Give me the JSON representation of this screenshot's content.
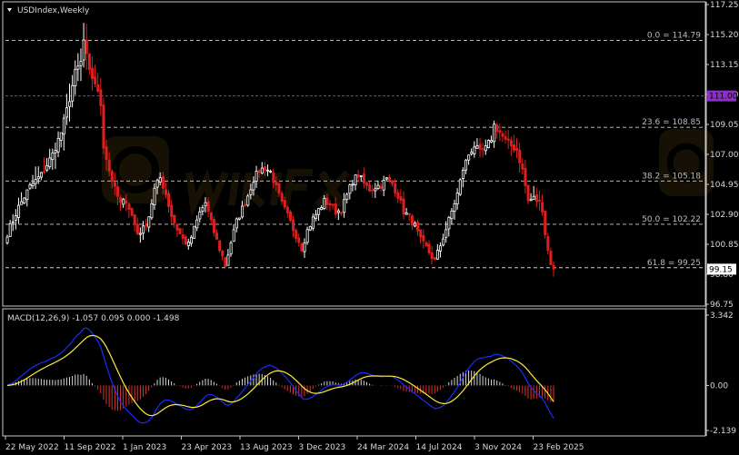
{
  "chart_data": [
    {
      "type": "candlestick",
      "title": "USDIndex,Weekly",
      "ylim": [
        96.75,
        117.25
      ],
      "y_ticks": [
        "117.25",
        "115.20",
        "113.15",
        "111.10",
        "109.05",
        "107.00",
        "104.95",
        "102.90",
        "100.85",
        "98.80",
        "96.75"
      ],
      "x_ticks": [
        "22 May 2022",
        "11 Sep 2022",
        "1 Jan 2023",
        "23 Apr 2023",
        "13 Aug 2023",
        "3 Dec 2023",
        "24 Mar 2024",
        "14 Jul 2024",
        "3 Nov 2024",
        "23 Feb 2025"
      ],
      "fibonacci": [
        {
          "label": "0.0 = 114.79",
          "value": 114.79
        },
        {
          "label": "23.6 = 108.85",
          "value": 108.85
        },
        {
          "label": "38.2 = 105.18",
          "value": 105.18
        },
        {
          "label": "50.0 = 102.22",
          "value": 102.22
        },
        {
          "label": "61.8 = 99.25",
          "value": 99.25
        }
      ],
      "hline": {
        "value": 111.0,
        "label": "111.00",
        "color": "#8b2fc9"
      },
      "current_price": {
        "value": 99.15,
        "label": "99.15"
      },
      "price_path": [
        [
          0,
          101.6
        ],
        [
          4,
          103.4
        ],
        [
          8,
          104.8
        ],
        [
          12,
          105.6
        ],
        [
          16,
          107.0
        ],
        [
          19,
          108.5
        ],
        [
          22,
          110.8
        ],
        [
          24,
          112.6
        ],
        [
          26,
          113.3
        ],
        [
          27,
          114.79
        ],
        [
          29,
          112.6
        ],
        [
          31,
          111.9
        ],
        [
          33,
          110.4
        ],
        [
          34,
          107.6
        ],
        [
          36,
          105.9
        ],
        [
          38,
          104.6
        ],
        [
          40,
          103.6
        ],
        [
          42,
          103.9
        ],
        [
          44,
          102.8
        ],
        [
          46,
          101.6
        ],
        [
          48,
          101.9
        ],
        [
          50,
          102.8
        ],
        [
          52,
          104.6
        ],
        [
          54,
          105.4
        ],
        [
          56,
          104.3
        ],
        [
          58,
          102.8
        ],
        [
          60,
          101.9
        ],
        [
          62,
          101.2
        ],
        [
          64,
          100.8
        ],
        [
          66,
          101.9
        ],
        [
          68,
          103.0
        ],
        [
          70,
          103.7
        ],
        [
          72,
          102.3
        ],
        [
          74,
          101.1
        ],
        [
          76,
          100.0
        ],
        [
          77,
          99.4
        ],
        [
          79,
          101.0
        ],
        [
          81,
          102.4
        ],
        [
          83,
          103.3
        ],
        [
          85,
          104.2
        ],
        [
          87,
          105.3
        ],
        [
          89,
          105.9
        ],
        [
          91,
          106.1
        ],
        [
          93,
          105.8
        ],
        [
          95,
          104.7
        ],
        [
          97,
          103.6
        ],
        [
          99,
          102.8
        ],
        [
          101,
          101.9
        ],
        [
          103,
          101.1
        ],
        [
          104,
          100.6
        ],
        [
          106,
          101.8
        ],
        [
          108,
          102.6
        ],
        [
          110,
          103.2
        ],
        [
          112,
          103.8
        ],
        [
          114,
          103.6
        ],
        [
          116,
          103.1
        ],
        [
          118,
          103.2
        ],
        [
          120,
          104.2
        ],
        [
          122,
          105.2
        ],
        [
          124,
          105.6
        ],
        [
          126,
          105.0
        ],
        [
          128,
          104.6
        ],
        [
          130,
          104.8
        ],
        [
          132,
          104.9
        ],
        [
          134,
          105.3
        ],
        [
          136,
          105.0
        ],
        [
          138,
          104.2
        ],
        [
          140,
          103.1
        ],
        [
          142,
          102.7
        ],
        [
          144,
          102.1
        ],
        [
          146,
          101.1
        ],
        [
          148,
          100.6
        ],
        [
          149,
          100.3
        ],
        [
          151,
          99.7
        ],
        [
          153,
          100.8
        ],
        [
          155,
          101.9
        ],
        [
          157,
          103.1
        ],
        [
          159,
          104.3
        ],
        [
          161,
          106.0
        ],
        [
          163,
          107.0
        ],
        [
          165,
          107.6
        ],
        [
          167,
          107.1
        ],
        [
          169,
          107.4
        ],
        [
          171,
          108.1
        ],
        [
          172,
          109.0
        ],
        [
          174,
          108.5
        ],
        [
          176,
          107.9
        ],
        [
          178,
          107.6
        ],
        [
          180,
          107.3
        ],
        [
          182,
          105.9
        ],
        [
          184,
          103.8
        ],
        [
          186,
          104.0
        ],
        [
          188,
          103.7
        ],
        [
          189,
          103.3
        ],
        [
          190,
          101.6
        ],
        [
          191,
          100.4
        ],
        [
          192,
          99.6
        ],
        [
          193,
          99.15
        ]
      ],
      "volatility": [
        [
          0,
          0.7
        ],
        [
          22,
          1.6
        ],
        [
          30,
          1.4
        ],
        [
          40,
          0.8
        ],
        [
          60,
          0.6
        ],
        [
          100,
          0.6
        ],
        [
          150,
          0.7
        ],
        [
          170,
          0.8
        ],
        [
          184,
          1.0
        ],
        [
          193,
          0.8
        ]
      ]
    },
    {
      "type": "macd",
      "title": "MACD(12,26,9) -1.057 0.095 0.000 -1.498",
      "params": [
        12,
        26,
        9
      ],
      "values": [
        -1.057,
        0.095,
        0.0,
        -1.498
      ],
      "ylim": [
        -2.139,
        3.342
      ],
      "y_ticks": [
        "3.342",
        "0.00",
        "-2.139"
      ],
      "colors": {
        "macd": "#1a2cff",
        "signal": "#ffeb3b",
        "hist_pos": "#d8d8d8",
        "hist_neg": "#e0342e"
      }
    }
  ],
  "colors": {
    "background": "#000000",
    "grid": "#c8c8c8",
    "bull": "#ffffff",
    "bear": "#e01e1e",
    "axis_text": "#d8d8d8"
  }
}
